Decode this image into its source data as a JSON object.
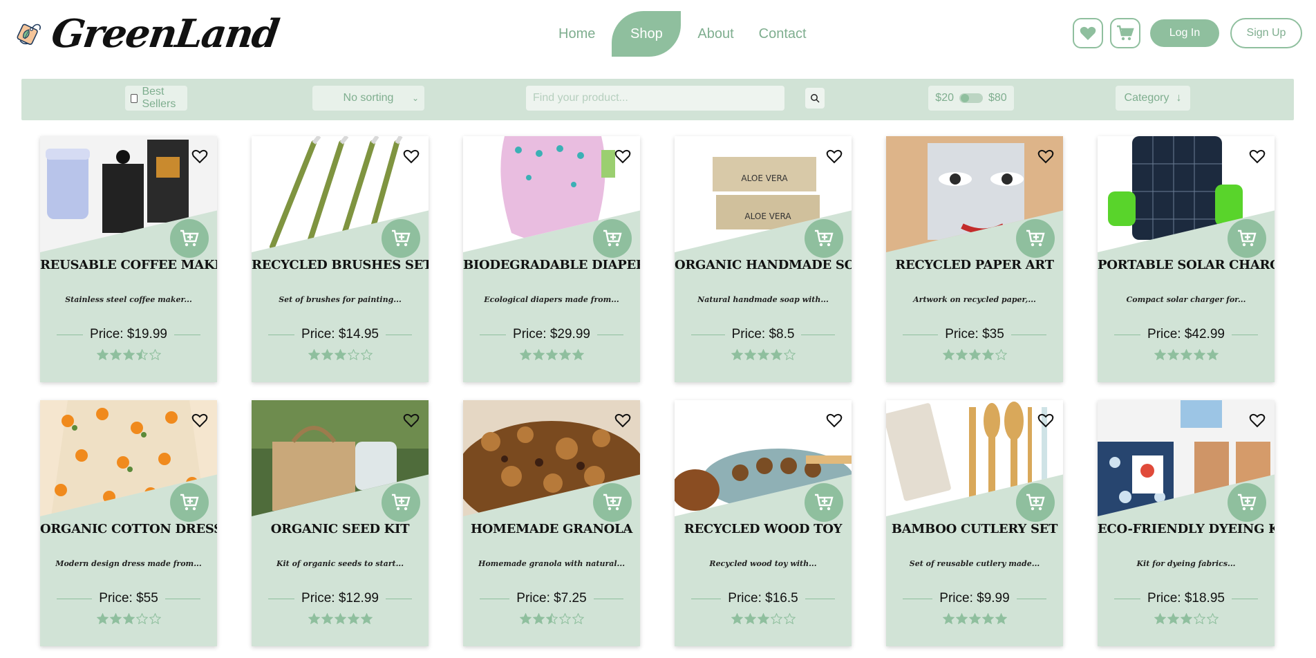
{
  "brand": {
    "name": "GreenLand"
  },
  "nav": {
    "items": [
      {
        "label": "Home",
        "active": false
      },
      {
        "label": "Shop",
        "active": true
      },
      {
        "label": "About",
        "active": false
      },
      {
        "label": "Contact",
        "active": false
      }
    ]
  },
  "header": {
    "login_label": "Log In",
    "signup_label": "Sign Up"
  },
  "filters": {
    "best_sellers_label": "Best Sellers",
    "best_sellers_checked": false,
    "sort_selected": "No sorting",
    "search_placeholder": "Find your product...",
    "price_min": "$20",
    "price_max": "$80",
    "category_label": "Category"
  },
  "colors": {
    "accent": "#8fbf9e",
    "card_bg": "#d1e3d6",
    "star_fill": "#8fbf9e"
  },
  "products": [
    {
      "title": "REUSABLE COFFEE MAKER",
      "desc": "Stainless steel coffee maker...",
      "price": "Price: $19.99",
      "rating": 3.5,
      "image": "coffee"
    },
    {
      "title": "RECYCLED BRUSHES SET",
      "desc": "Set of brushes for painting...",
      "price": "Price: $14.95",
      "rating": 3,
      "image": "brushes"
    },
    {
      "title": "BIODEGRADABLE DIAPERS",
      "desc": "Ecological diapers made from...",
      "price": "Price: $29.99",
      "rating": 5,
      "image": "diapers"
    },
    {
      "title": "ORGANIC HANDMADE SOAP",
      "desc": "Natural handmade soap with...",
      "price": "Price: $8.5",
      "rating": 4,
      "image": "soap"
    },
    {
      "title": "RECYCLED PAPER ART",
      "desc": "Artwork on recycled paper,...",
      "price": "Price: $35",
      "rating": 4,
      "image": "paperart"
    },
    {
      "title": "PORTABLE SOLAR CHARGER",
      "desc": "Compact solar charger for...",
      "price": "Price: $42.99",
      "rating": 5,
      "image": "solar"
    },
    {
      "title": "ORGANIC COTTON DRESS",
      "desc": "Modern design dress made from...",
      "price": "Price: $55",
      "rating": 3,
      "image": "dress"
    },
    {
      "title": "ORGANIC SEED KIT",
      "desc": "Kit of organic seeds to start...",
      "price": "Price: $12.99",
      "rating": 5,
      "image": "seedkit"
    },
    {
      "title": "HOMEMADE GRANOLA",
      "desc": "Homemade granola with natural...",
      "price": "Price: $7.25",
      "rating": 2.5,
      "image": "granola"
    },
    {
      "title": "RECYCLED WOOD TOY",
      "desc": "Recycled wood toy with...",
      "price": "Price: $16.5",
      "rating": 3,
      "image": "woodtoy"
    },
    {
      "title": "BAMBOO CUTLERY SET",
      "desc": "Set of reusable cutlery made...",
      "price": "Price: $9.99",
      "rating": 5,
      "image": "cutlery"
    },
    {
      "title": "ECO-FRIENDLY DYEING KIT",
      "desc": "Kit for dyeing fabrics...",
      "price": "Price: $18.95",
      "rating": 3,
      "image": "dyeing"
    }
  ]
}
